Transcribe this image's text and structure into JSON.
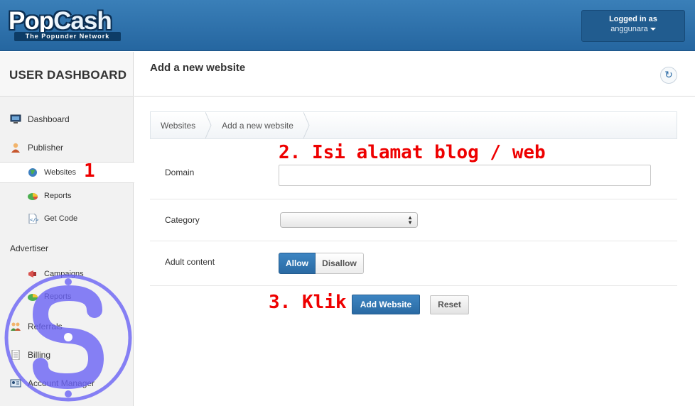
{
  "header": {
    "logo_brand_1": "Pop",
    "logo_brand_2": "Cash",
    "logo_tagline": "The Popunder Network",
    "logged_in_label": "Logged in as",
    "username": "anggunara"
  },
  "sidebar": {
    "title": "USER DASHBOARD",
    "items": [
      {
        "label": "Dashboard",
        "icon": "monitor-icon"
      },
      {
        "label": "Publisher",
        "icon": "user-icon"
      },
      {
        "label": "Websites",
        "icon": "globe-icon"
      },
      {
        "label": "Reports",
        "icon": "pie-chart-icon"
      },
      {
        "label": "Get Code",
        "icon": "code-file-icon"
      }
    ],
    "advertiser_label": "Advertiser",
    "advertiser_items": [
      {
        "label": "Campaigns",
        "icon": "megaphone-icon"
      },
      {
        "label": "Reports",
        "icon": "pie-chart-icon"
      }
    ],
    "bottom_items": [
      {
        "label": "Referrals",
        "icon": "people-icon"
      },
      {
        "label": "Billing",
        "icon": "document-icon"
      },
      {
        "label": "Account Manager",
        "icon": "id-card-icon"
      }
    ]
  },
  "main": {
    "page_title": "Add a new website",
    "breadcrumb": [
      "Websites",
      "Add a new website"
    ],
    "form": {
      "domain_label": "Domain",
      "domain_value": "",
      "category_label": "Category",
      "category_value": "",
      "adult_label": "Adult content",
      "allow_label": "Allow",
      "disallow_label": "Disallow",
      "add_button": "Add Website",
      "reset_button": "Reset"
    }
  },
  "annotations": {
    "step1": "1",
    "step2": "2. Isi alamat blog / web",
    "step3": "3. Klik >"
  },
  "colors": {
    "header": "#2f73ad",
    "primary_button": "#2a6aa3",
    "annotation": "#ee0000",
    "watermark": "#6b63f5"
  }
}
